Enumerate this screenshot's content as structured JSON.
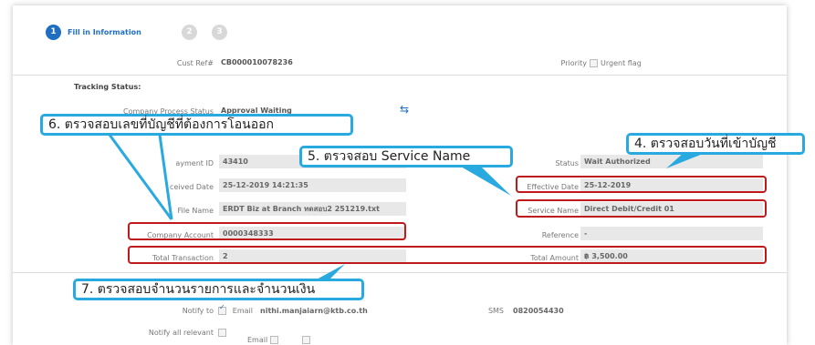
{
  "steps": [
    {
      "num": "1",
      "label": "Fill in Information"
    },
    {
      "num": "2"
    },
    {
      "num": "3"
    }
  ],
  "header": {
    "cust_ref_label": "Cust Ref#",
    "cust_ref_value": "CB000010078236",
    "priority_label": "Priority",
    "urgent_label": "Urgent flag"
  },
  "tracking": {
    "title": "Tracking Status:",
    "process_label": "Company Process Status",
    "process_value": "Approval Waiting"
  },
  "details": {
    "payment_id_label": "ayment ID",
    "payment_id_value": "43410",
    "status_label": "Status",
    "status_value": "Wait Authorized",
    "received_label": "ceived Date",
    "received_value": "25-12-2019 14:21:35",
    "effective_label": "Effective Date",
    "effective_value": "25-12-2019",
    "file_label": "File Name",
    "file_value": "ERDT Biz at Branch ทดสอบ2 251219.txt",
    "service_label": "Service Name",
    "service_value": "Direct Debit/Credit 01",
    "account_label": "Company Account",
    "account_value": "0000348333",
    "reference_label": "Reference",
    "reference_value": "-",
    "total_tx_label": "Total Transaction",
    "total_tx_value": "2",
    "total_amount_label": "Total Amount",
    "total_amount_value": "฿ 3,500.00"
  },
  "notify": {
    "notify_to_label": "Notify to",
    "email_label": "Email",
    "email_value": "nithi.manjaiarn@ktb.co.th",
    "sms_label": "SMS",
    "sms_value": "0820054430",
    "notify_all_label": "Notify all relevant",
    "email_opt_label": "Email",
    "sms_opt_label": "SMS"
  },
  "callouts": {
    "c4": "4. ตรวจสอบวันที่เข้าบัญชี",
    "c5": "5. ตรวจสอบ Service Name",
    "c6": "6. ตรวจสอบเลขที่บัญชีที่ต้องการโอนออก",
    "c7": "7. ตรวจสอบจำนวนรายการและจำนวนเงิน"
  },
  "colors": {
    "step_active": "#1e6fc2",
    "step_inactive": "#d8d8d8",
    "highlight_border": "#c0191b",
    "callout_border": "#28a9e0"
  }
}
